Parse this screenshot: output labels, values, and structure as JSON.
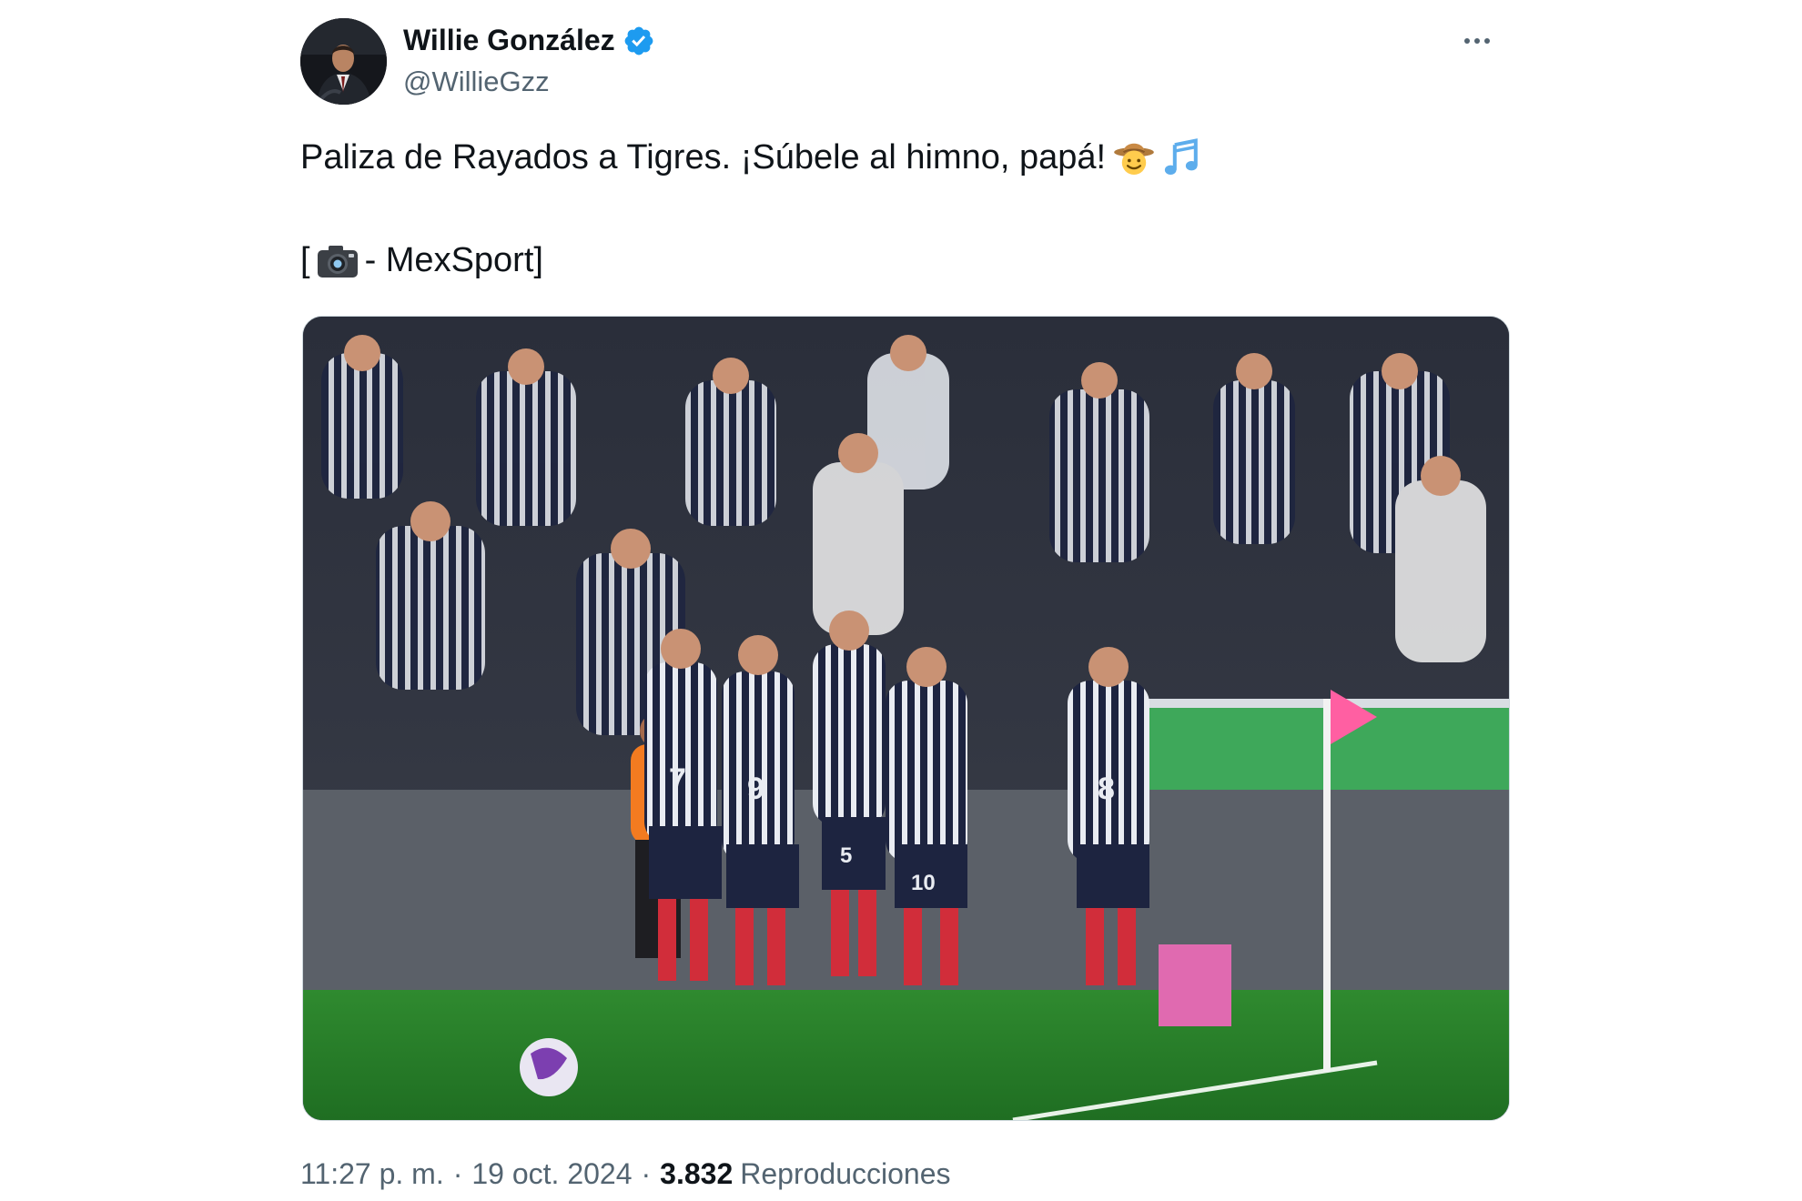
{
  "author": {
    "display_name": "Willie González",
    "handle": "@WillieGzz",
    "verified": true,
    "verified_icon": "verified-badge-icon",
    "verified_color": "#1d9bf0"
  },
  "menu": {
    "icon": "more-options-icon"
  },
  "post": {
    "line1_text": "Paliza de Rayados a Tigres. ¡Súbele al himno, papá!",
    "line1_emojis": [
      "cowboy-face-emoji",
      "musical-notes-emoji"
    ],
    "line2_prefix": "[",
    "line2_icon": "camera-emoji",
    "line2_suffix": " - MexSport]"
  },
  "media": {
    "type": "photo",
    "subject": "soccer-goal-celebration",
    "jersey_numbers": [
      "7",
      "9",
      "5",
      "10",
      "8"
    ]
  },
  "meta": {
    "time": "11:27 p. m.",
    "separator": "·",
    "date": "19 oct. 2024",
    "views_count": "3.832",
    "views_label": "Reproducciones"
  },
  "colors": {
    "text_primary": "#0f1419",
    "text_secondary": "#536471",
    "accent": "#1d9bf0",
    "border": "#cfd9de"
  }
}
